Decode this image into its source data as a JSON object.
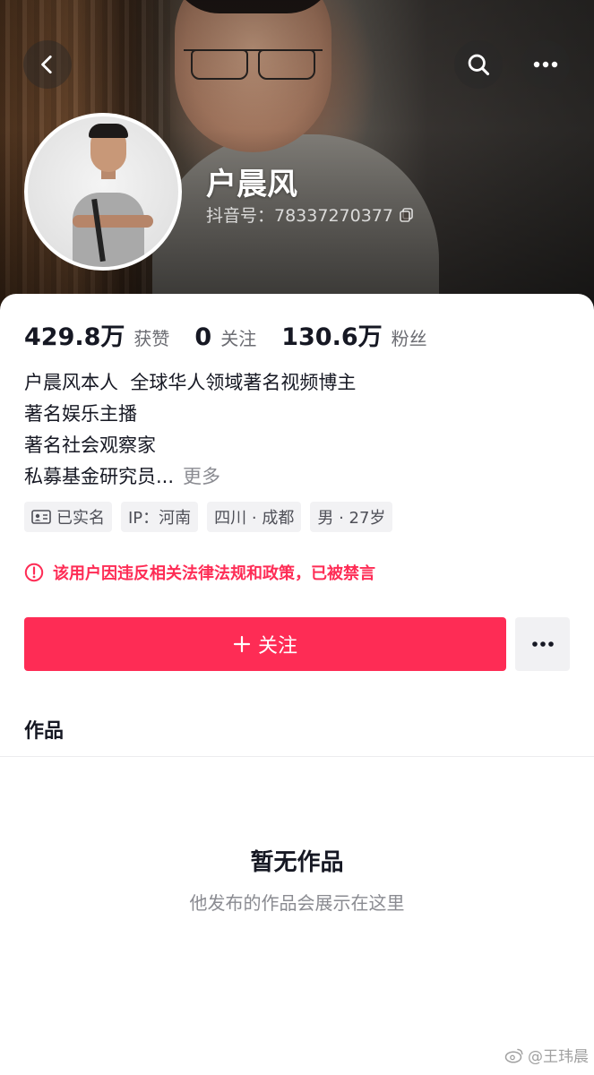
{
  "header": {
    "back_icon": "chevron-left-icon",
    "search_icon": "search-icon",
    "more_icon": "more-horizontal-icon"
  },
  "profile": {
    "nickname": "户晨风",
    "douyin_id": "抖音号：78337270377",
    "copy_icon": "copy-icon"
  },
  "stats": [
    {
      "value": "429.8万",
      "label": "获赞"
    },
    {
      "value": "0",
      "label": "关注"
    },
    {
      "value": "130.6万",
      "label": "粉丝"
    }
  ],
  "bio": {
    "lines": [
      "户晨风本人  全球华人领域著名视频博主",
      "著名娱乐主播",
      "著名社会观察家",
      "私募基金研究员..."
    ],
    "more": "更多"
  },
  "tags": [
    {
      "label": "已实名",
      "icon": "id-card-icon"
    },
    {
      "label": "IP：河南"
    },
    {
      "label": "四川 · 成都"
    },
    {
      "label": "男 · 27岁"
    }
  ],
  "ban_notice": {
    "text": "该用户因违反相关法律法规和政策，已被禁言",
    "icon": "alert-circle-icon",
    "color": "#fe2c55"
  },
  "actions": {
    "follow_label": "关注",
    "follow_icon": "plus-icon",
    "more_icon": "more-horizontal-icon",
    "accent": "#fe2c55"
  },
  "tabs": {
    "works": "作品"
  },
  "empty_state": {
    "title": "暂无作品",
    "subtitle": "他发布的作品会展示在这里"
  },
  "watermark": {
    "text": "@王玮晨",
    "icon": "weibo-icon"
  }
}
